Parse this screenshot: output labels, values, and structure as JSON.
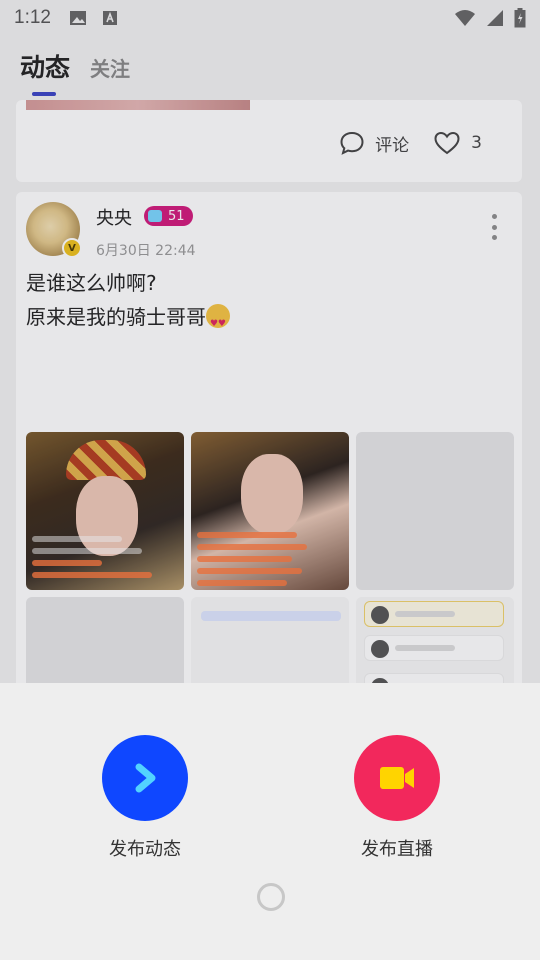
{
  "status_bar": {
    "time": "1:12"
  },
  "tabs": [
    {
      "label": "动态"
    },
    {
      "label": "关注"
    }
  ],
  "prev_post": {
    "comment_label": "评论",
    "like_count": "3"
  },
  "post": {
    "user_name": "央央",
    "level": "51",
    "time": "6月30日 22:44",
    "text_line1": "是谁这么帅啊?",
    "text_line2": "原来是我的骑士哥哥"
  },
  "sheet": {
    "post_moment_label": "发布动态",
    "go_live_label": "发布直播"
  },
  "colors": {
    "accent_tab": "#3a43c5",
    "post_button": "#0f47ff",
    "live_button": "#f2285c",
    "level_badge": "#d2187b"
  }
}
